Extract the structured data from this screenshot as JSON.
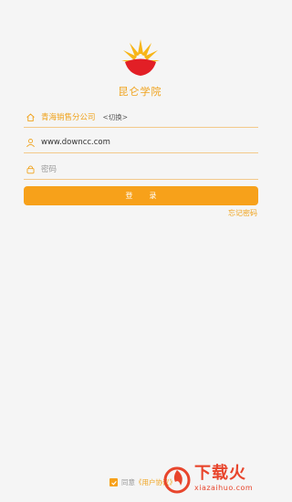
{
  "app": {
    "name": "昆仑学院"
  },
  "org": {
    "name": "青海销售分公司",
    "switch_label": "<切换>"
  },
  "username": {
    "value": "www.downcc.com"
  },
  "password": {
    "placeholder": "密码"
  },
  "login": {
    "label": "登录"
  },
  "forgot": {
    "label": "忘记密码"
  },
  "agreement": {
    "prefix": "同意",
    "link": "《用户协议》"
  },
  "watermark": {
    "title": "下载火",
    "sub": "xiazaihuo.com"
  },
  "colors": {
    "accent": "#f7a11a",
    "logo_red": "#e21f26",
    "logo_yellow": "#f7b517"
  }
}
